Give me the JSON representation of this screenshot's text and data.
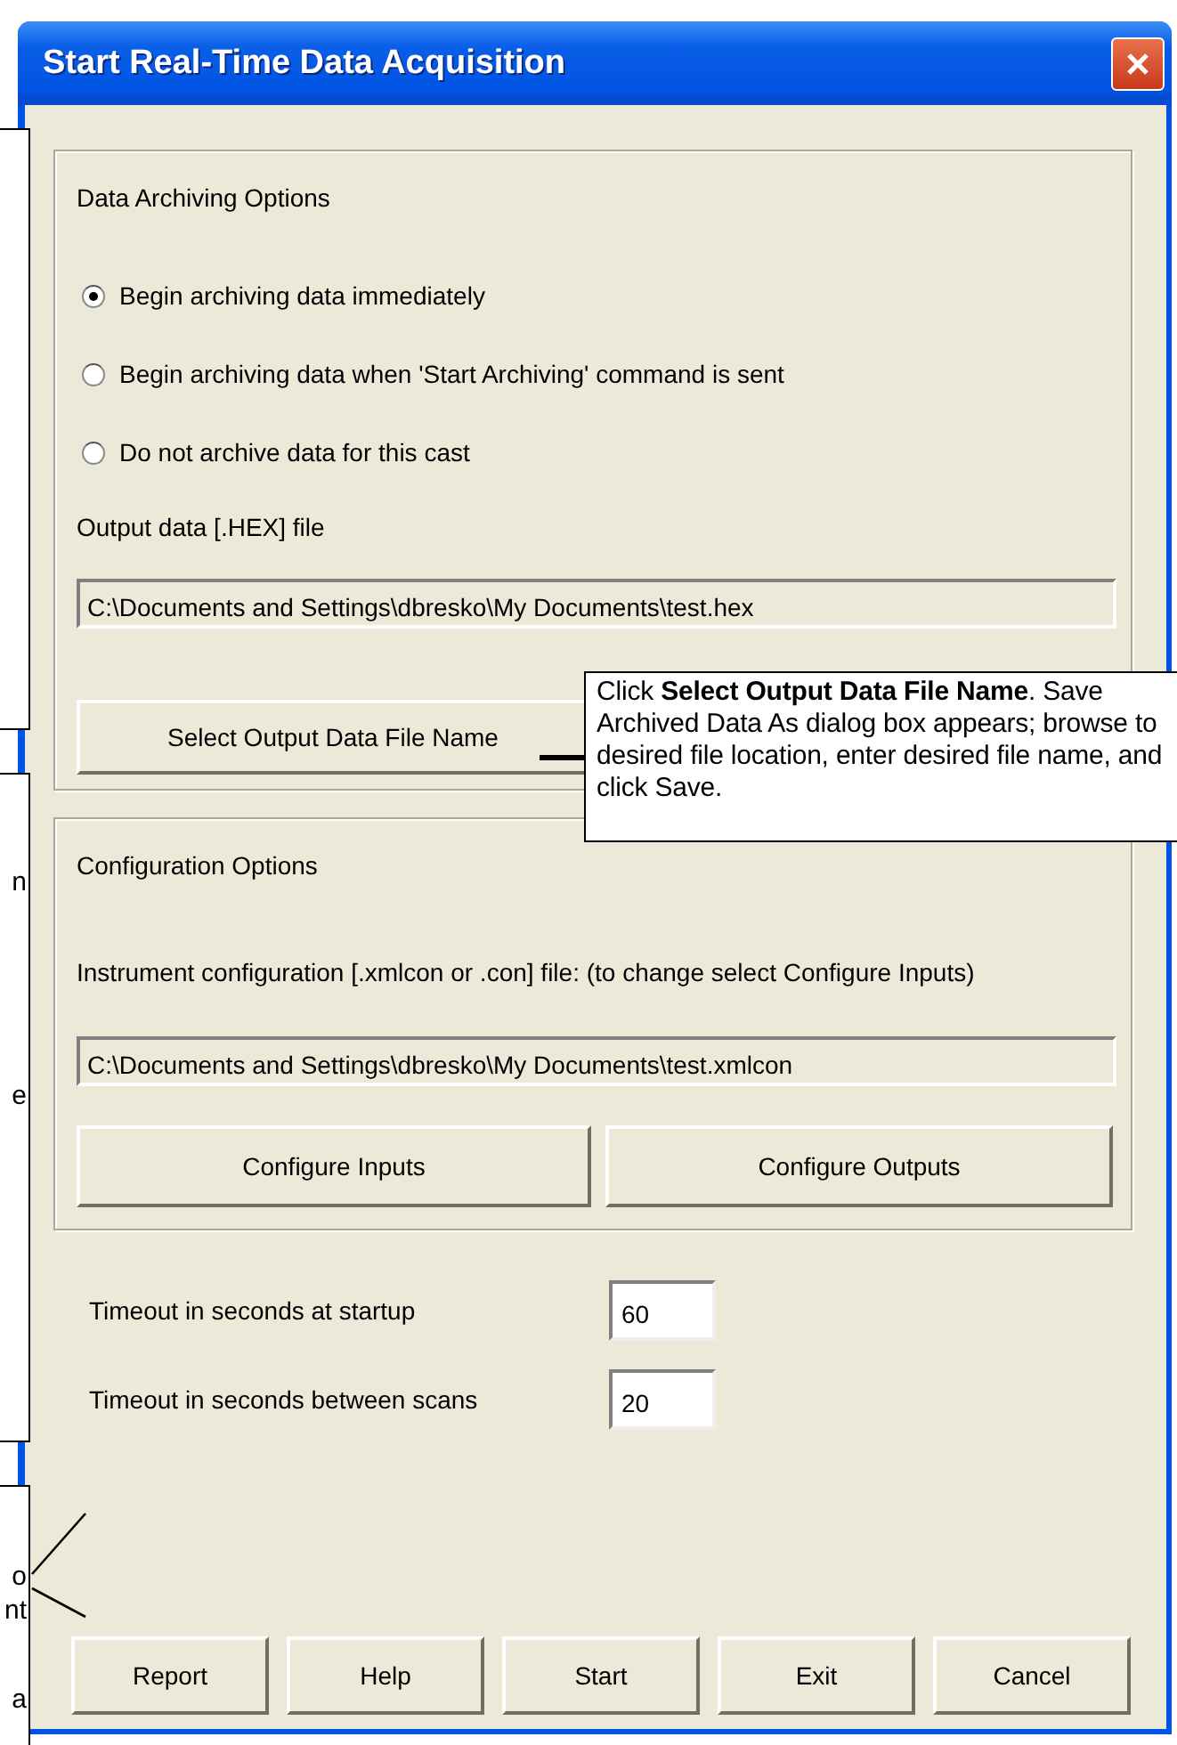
{
  "window": {
    "title": "Start Real-Time Data Acquisition"
  },
  "archiving": {
    "title": "Data Archiving Options",
    "options": [
      {
        "label": "Begin archiving data immediately",
        "selected": true
      },
      {
        "label": "Begin archiving data when 'Start Archiving' command is sent",
        "selected": false
      },
      {
        "label": "Do not archive data for this cast",
        "selected": false
      }
    ],
    "output_label": "Output data [.HEX] file",
    "output_path": "C:\\Documents and Settings\\dbresko\\My Documents\\test.hex",
    "select_button": "Select Output Data File Name"
  },
  "configuration": {
    "title": "Configuration Options",
    "instrument_label": "Instrument configuration [.xmlcon or .con] file: (to change select Configure Inputs)",
    "instrument_path": "C:\\Documents and Settings\\dbresko\\My Documents\\test.xmlcon",
    "buttons": [
      "Configure Inputs",
      "Configure Outputs"
    ]
  },
  "timeouts": [
    {
      "label": "Timeout in seconds at startup",
      "value": "60"
    },
    {
      "label": "Timeout in seconds between scans",
      "value": "20"
    }
  ],
  "buttons": [
    "Report",
    "Help",
    "Start",
    "Exit",
    "Cancel"
  ],
  "callout": {
    "text": "Click **Select Output Data File Name**. Save Archived Data As dialog box appears; browse to desired file location, enter desired file name, and click Save."
  },
  "side_notes": [
    {
      "kind": "note"
    },
    {
      "kind": "note",
      "fragments": [
        "n",
        "e"
      ]
    },
    {
      "kind": "note",
      "fragments": [
        "o",
        "nt",
        "a"
      ]
    }
  ]
}
